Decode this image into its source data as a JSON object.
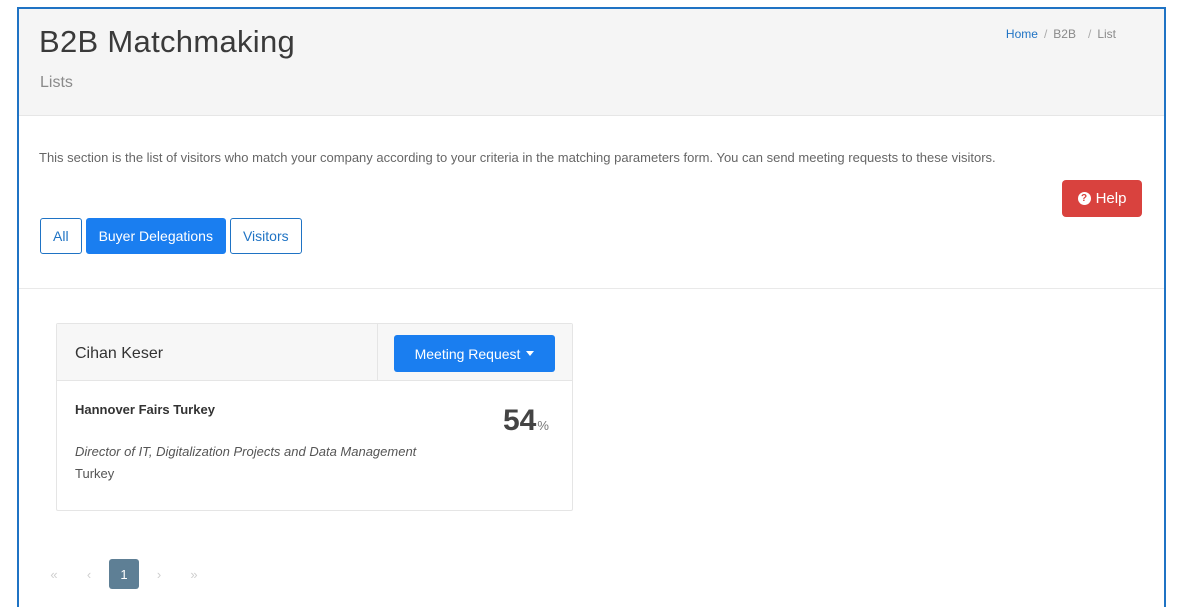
{
  "page": {
    "title": "B2B Matchmaking",
    "subtitle": "Lists",
    "breadcrumb": {
      "home": "Home",
      "b2b": "B2B",
      "list": "List",
      "separator": "/"
    }
  },
  "description": "This section is the list of visitors who match your company according to your criteria in the matching parameters form. You can send meeting requests to these visitors.",
  "help_button": {
    "label": "Help",
    "icon": "question-circle-icon"
  },
  "filters": [
    "All",
    "Buyer Delegations",
    "Visitors"
  ],
  "active_filter": "Buyer Delegations",
  "card": {
    "name": "Cihan Keser",
    "action_label": "Meeting Request",
    "company": "Hannover Fairs Turkey",
    "score": "54",
    "score_unit": "%",
    "job_title": "Director of IT, Digitalization Projects and Data Management",
    "country": "Turkey"
  },
  "pagination": {
    "first": "«",
    "prev": "‹",
    "current": "1",
    "next": "›",
    "last": "»"
  },
  "colors": {
    "primary": "#1a7ef0",
    "danger": "#d9423e",
    "frame": "#1f73c4",
    "pager_active": "#5e7f95"
  }
}
